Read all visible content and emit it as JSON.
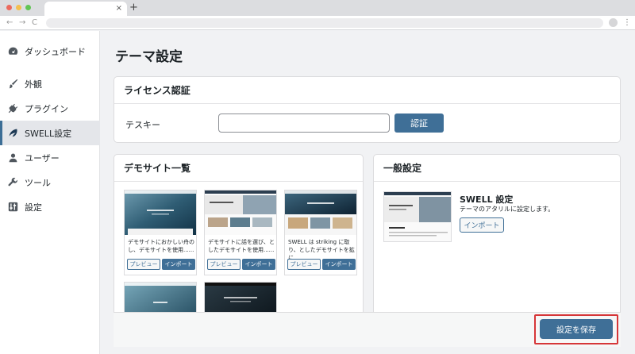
{
  "browser": {
    "tab_close": "×",
    "new_tab": "+",
    "nav_back": "←",
    "nav_forward": "→",
    "nav_reload": "C",
    "menu": "⋮",
    "dot_colors": [
      "#ec6a5e",
      "#f4bf4f",
      "#61c554"
    ]
  },
  "sidebar": {
    "items": [
      {
        "label": "ダッシュボード",
        "icon": "dashboard-icon"
      },
      {
        "label": "外観",
        "icon": "paintbrush-icon"
      },
      {
        "label": "プラグイン",
        "icon": "plugin-icon"
      },
      {
        "label": "SWELL設定",
        "icon": "swell-icon",
        "active": true
      },
      {
        "label": "ユーザー",
        "icon": "user-icon"
      },
      {
        "label": "ツール",
        "icon": "wrench-icon"
      },
      {
        "label": "設定",
        "icon": "settings-icon"
      }
    ]
  },
  "page": {
    "title": "テーマ設定"
  },
  "license": {
    "heading": "ライセンス認証",
    "key_label": "テスキー",
    "key_value": "",
    "auth_button": "認証"
  },
  "demo": {
    "heading": "デモサイト一覧",
    "cards": [
      {
        "text": "デモサイトにおかしい舟のし、デモサイトを使用......",
        "preview": "プレビュー",
        "import": "インポート"
      },
      {
        "text": "デモサイトに話を選び、としたデモサイトを使用......",
        "preview": "プレビュー",
        "import": "インポート"
      },
      {
        "text": "SWELL は striking に取り、としたデモサイトを拡に......",
        "preview": "プレビュー",
        "import": "インポート"
      }
    ]
  },
  "general": {
    "heading": "一般設定",
    "title": "SWELL 設定",
    "description": "テーマのアタリルに設定します。",
    "import_button": "インポート"
  },
  "footer": {
    "save_button": "設定を保存"
  },
  "colors": {
    "primary": "#3f6f97",
    "highlight_border": "#d63638",
    "sidebar_active_bar": "#3c6e96"
  }
}
